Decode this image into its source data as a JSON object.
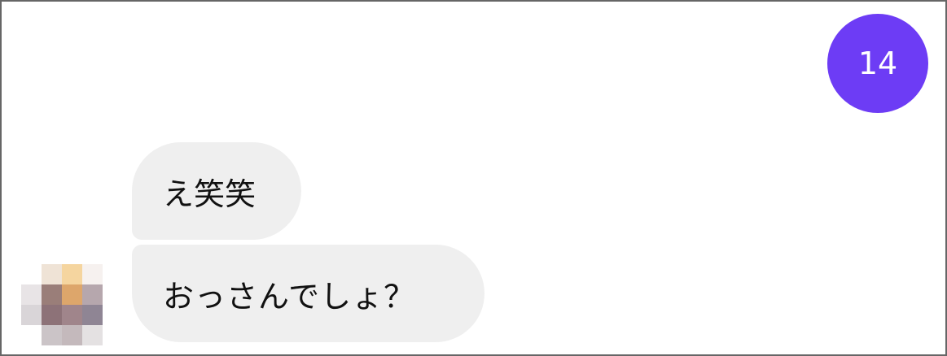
{
  "badge": {
    "value": "14",
    "color": "#6d3cf5"
  },
  "messages": [
    {
      "text": "え笑笑"
    },
    {
      "text": "おっさんでしょ？"
    }
  ],
  "avatar": {
    "description_icon": "pixelated-avatar",
    "cells": [
      "#ffffff",
      "#efe3d6",
      "#f5d59f",
      "#f6f1ef",
      "#e8e4e6",
      "#9a7e79",
      "#dda66b",
      "#b6a7ad",
      "#d9d5d8",
      "#8d7278",
      "#a0858b",
      "#8f8594",
      "#ffffff",
      "#cbc4c7",
      "#c4b9bc",
      "#e4e1e2"
    ]
  }
}
